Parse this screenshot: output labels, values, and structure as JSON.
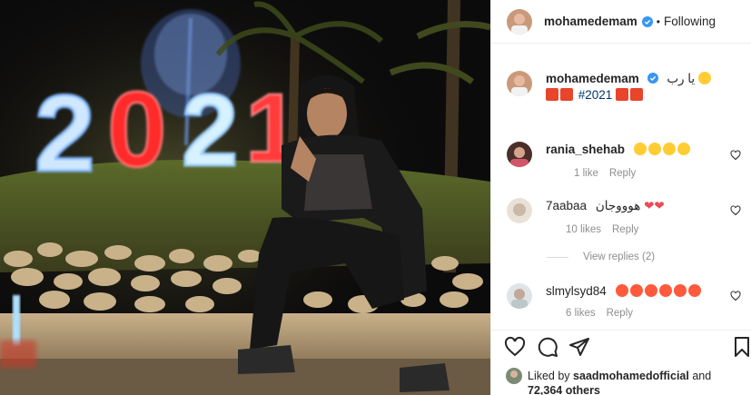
{
  "post": {
    "sign_text": "2021"
  },
  "header": {
    "username": "mohamedemam",
    "separator": "•",
    "follow_label": "Following"
  },
  "caption": {
    "username": "mohamedemam",
    "text_line1": "يا رب",
    "hashtag": "#2021"
  },
  "comments": [
    {
      "username": "rania_shehab",
      "text": "",
      "likes": "1 like",
      "reply": "Reply"
    },
    {
      "username": "7aabaa",
      "text": "هوووجان",
      "likes": "10 likes",
      "reply": "Reply",
      "view_replies": "View replies (2)"
    },
    {
      "username": "slmylsyd84",
      "text": "",
      "likes": "6 likes",
      "reply": "Reply"
    }
  ],
  "likes_line": {
    "prefix": "Liked by",
    "liker": "saadmohamedofficial",
    "and": "and",
    "count": "72,364 others"
  },
  "colors": {
    "verified": "#3897f0",
    "meta_gray": "#8e8e8e",
    "heart_red": "#ed4956"
  },
  "icons": [
    "heart-icon",
    "comment-icon",
    "share-icon",
    "bookmark-icon",
    "verified-badge-icon"
  ]
}
